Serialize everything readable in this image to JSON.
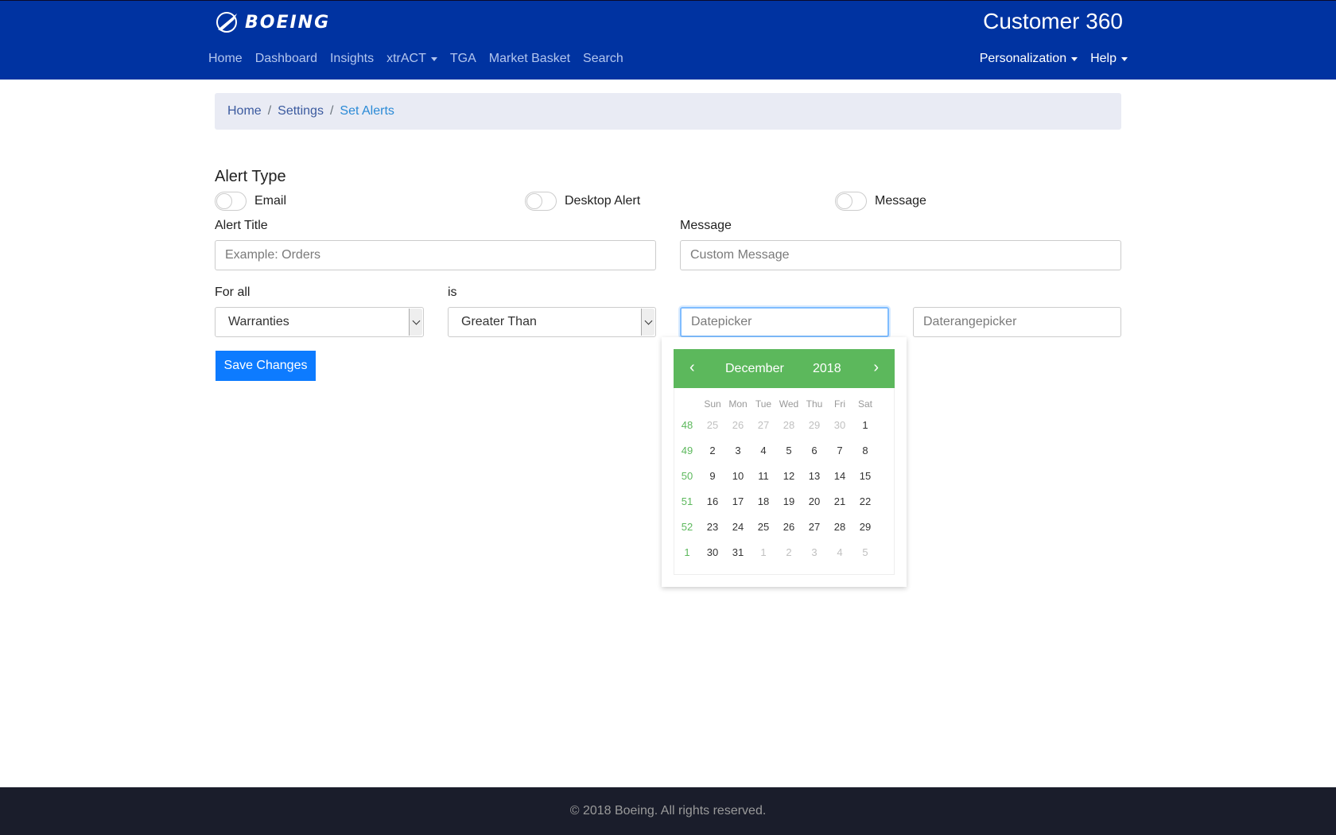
{
  "header": {
    "logo_text": "BOEING",
    "app_title": "Customer 360",
    "nav": [
      "Home",
      "Dashboard",
      "Insights",
      "xtrACT",
      "TGA",
      "Market Basket",
      "Search"
    ],
    "nav_right": [
      "Personalization",
      "Help"
    ]
  },
  "breadcrumb": {
    "home": "Home",
    "settings": "Settings",
    "current": "Set Alerts",
    "sep": "/"
  },
  "form": {
    "section_title": "Alert Type",
    "toggles": [
      "Email",
      "Desktop Alert",
      "Message"
    ],
    "alert_title_label": "Alert Title",
    "alert_title_placeholder": "Example: Orders",
    "message_label": "Message",
    "message_placeholder": "Custom Message",
    "for_all_label": "For all",
    "for_all_value": "Warranties",
    "is_label": "is",
    "is_value": "Greater Than",
    "datepicker_placeholder": "Datepicker",
    "daterange_placeholder": "Daterangepicker",
    "save_label": "Save Changes"
  },
  "datepicker": {
    "prev": "‹",
    "next": "›",
    "month": "December",
    "year": "2018",
    "dow": [
      "Sun",
      "Mon",
      "Tue",
      "Wed",
      "Thu",
      "Fri",
      "Sat"
    ],
    "weeks": [
      {
        "week": "48",
        "days": [
          "25",
          "26",
          "27",
          "28",
          "29",
          "30",
          "1"
        ],
        "muted": [
          true,
          true,
          true,
          true,
          true,
          true,
          false
        ]
      },
      {
        "week": "49",
        "days": [
          "2",
          "3",
          "4",
          "5",
          "6",
          "7",
          "8"
        ],
        "muted": [
          false,
          false,
          false,
          false,
          false,
          false,
          false
        ]
      },
      {
        "week": "50",
        "days": [
          "9",
          "10",
          "11",
          "12",
          "13",
          "14",
          "15"
        ],
        "muted": [
          false,
          false,
          false,
          false,
          false,
          false,
          false
        ]
      },
      {
        "week": "51",
        "days": [
          "16",
          "17",
          "18",
          "19",
          "20",
          "21",
          "22"
        ],
        "muted": [
          false,
          false,
          false,
          false,
          false,
          false,
          false
        ]
      },
      {
        "week": "52",
        "days": [
          "23",
          "24",
          "25",
          "26",
          "27",
          "28",
          "29"
        ],
        "muted": [
          false,
          false,
          false,
          false,
          false,
          false,
          false
        ]
      },
      {
        "week": "1",
        "days": [
          "30",
          "31",
          "1",
          "2",
          "3",
          "4",
          "5"
        ],
        "muted": [
          false,
          false,
          true,
          true,
          true,
          true,
          true
        ]
      }
    ]
  },
  "footer": {
    "text": "© 2018 Boeing. All rights reserved."
  },
  "colors": {
    "header_bg": "#0033a1",
    "accent": "#5cb85c",
    "primary_button": "#0d7bff",
    "footer_bg": "#1a1d2b"
  },
  "icons": [
    "boeing-logo-icon",
    "caret-down-icon",
    "chevron-down-icon",
    "chevron-left-icon",
    "chevron-right-icon"
  ]
}
